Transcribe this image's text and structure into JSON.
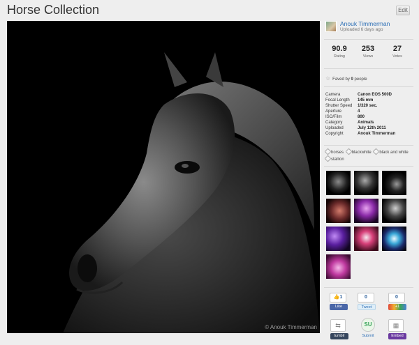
{
  "header": {
    "title": "Horse Collection",
    "edit_label": "Edit"
  },
  "photo": {
    "copyright": "© Anouk Timmerman",
    "subject": "black-and-white horse portrait"
  },
  "author": {
    "name": "Anouk Timmerman",
    "uploaded_ago": "Uploaded 6 days ago"
  },
  "stats": [
    {
      "value": "90.9",
      "label": "Rating"
    },
    {
      "value": "253",
      "label": "Views"
    },
    {
      "value": "27",
      "label": "Votes"
    }
  ],
  "faved": {
    "prefix": "Faved by ",
    "count": "9",
    "suffix": " people"
  },
  "exif": [
    {
      "key": "Camera",
      "value": "Canon EOS 500D"
    },
    {
      "key": "Focal Length",
      "value": "145 mm"
    },
    {
      "key": "Shutter Speed",
      "value": "1/320 sec."
    },
    {
      "key": "Aperture",
      "value": "4"
    },
    {
      "key": "ISO/Film",
      "value": "800"
    },
    {
      "key": "Category",
      "value": "Animals"
    },
    {
      "key": "Uploaded",
      "value": "July 12th 2011"
    },
    {
      "key": "Copyright",
      "value": "Anouk Timmerman"
    }
  ],
  "tags": [
    "horses",
    "blackwhite",
    "black and white",
    "stallion"
  ],
  "share": {
    "facebook_count": "1",
    "facebook_label": "Like",
    "tweet_count": "0",
    "tweet_label": "Tweet",
    "plusone_count": "0",
    "plusone_label": "+1",
    "tumblr_label": "tumblr",
    "stumble_label": "Submit",
    "embed_label": "Embed"
  },
  "colors": {
    "link": "#2a6db5",
    "facebook": "#4a67a8",
    "tumblr": "#36465d",
    "embed": "#6a3aa0",
    "plusone": "#e0483a"
  },
  "icons": {
    "star": "star-icon",
    "stumble": "stumbleupon-icon",
    "tumblr": "tumblr-icon",
    "embed": "embed-icon"
  }
}
